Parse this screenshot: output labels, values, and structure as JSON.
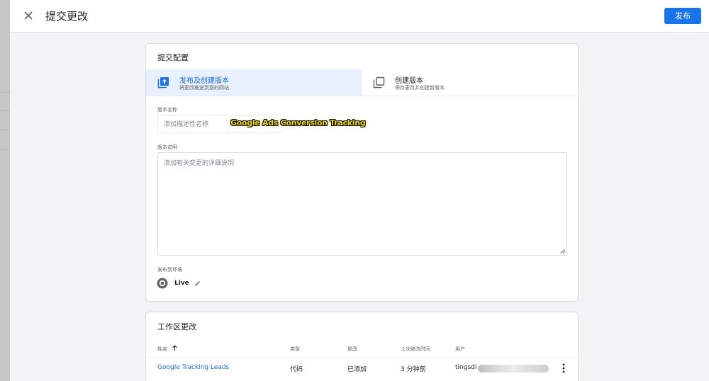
{
  "header": {
    "title": "提交更改",
    "publish_label": "发布"
  },
  "config": {
    "title": "提交配置",
    "options": [
      {
        "title": "发布及创建版本",
        "subtitle": "将更改推送到您的网站"
      },
      {
        "title": "创建版本",
        "subtitle": "保存更改并创建新版本"
      }
    ],
    "version_name_label": "版本名称",
    "version_name_placeholder": "添加描述性名称",
    "watermark": "Google Ads Conversion Tracking",
    "version_desc_label": "版本说明",
    "version_desc_placeholder": "添加有关变更的详细说明",
    "env_label": "发布到环境",
    "env_name": "Live"
  },
  "changes": {
    "title": "工作区更改",
    "columns": [
      "姓名",
      "类型",
      "更改",
      "上次修改时间",
      "用户"
    ],
    "rows": [
      {
        "name": "Google Tracking Leads",
        "type": "代码",
        "change": "已添加",
        "modified": "3 分钟前",
        "user": "tingsdi"
      }
    ]
  },
  "colors": {
    "accent": "#1a73e8",
    "selected_bg": "#e8f0fe",
    "link": "#1967d2"
  }
}
